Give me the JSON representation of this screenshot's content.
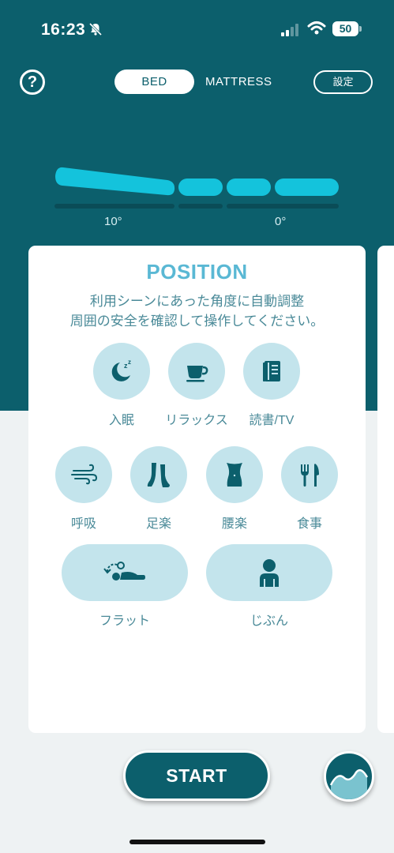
{
  "status_bar": {
    "time": "16:23",
    "battery": "50"
  },
  "header": {
    "help_label": "?",
    "tabs": [
      {
        "label": "BED",
        "selected": true
      },
      {
        "label": "MATTRESS",
        "selected": false
      }
    ],
    "settings_label": "設定"
  },
  "bed": {
    "head_angle": "10°",
    "foot_angle": "0°"
  },
  "card": {
    "title": "POSITION",
    "description_line1": "利用シーンにあった角度に自動調整",
    "description_line2": "周囲の安全を確認して操作してください。",
    "positions": [
      {
        "label": "入眠",
        "icon": "sleep-icon"
      },
      {
        "label": "リラックス",
        "icon": "coffee-cup-icon"
      },
      {
        "label": "読書/TV",
        "icon": "book-icon"
      },
      {
        "label": "呼吸",
        "icon": "wind-icon"
      },
      {
        "label": "足楽",
        "icon": "feet-icon"
      },
      {
        "label": "腰楽",
        "icon": "waist-icon"
      },
      {
        "label": "食事",
        "icon": "fork-knife-icon"
      },
      {
        "label": "フラット",
        "icon": "flat-icon"
      },
      {
        "label": "じぶん",
        "icon": "person-icon"
      }
    ]
  },
  "footer": {
    "start_label": "START"
  },
  "colors": {
    "primary": "#0c5f6c",
    "accent": "#5ab8d4",
    "button_bg": "#c3e4ec",
    "bed_segment": "#14c3dc"
  }
}
